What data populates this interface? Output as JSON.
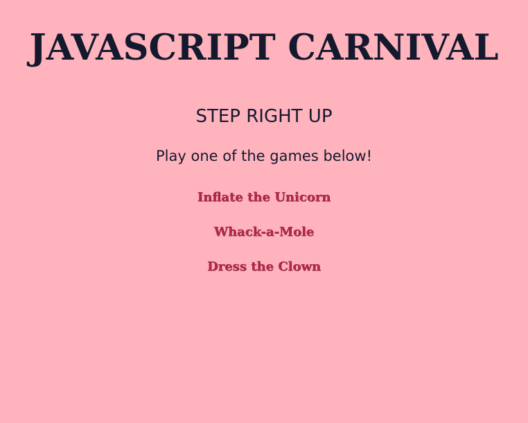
{
  "header": {
    "title": "JAVASCRIPT CARNIVAL"
  },
  "main": {
    "subtitle": "STEP RIGHT UP",
    "intro": "Play one of the games below!",
    "games": [
      {
        "label": "Inflate the Unicorn"
      },
      {
        "label": "Whack-a-Mole"
      },
      {
        "label": "Dress the Clown"
      }
    ]
  },
  "colors": {
    "background": "#ffb3bd",
    "text": "#14192e",
    "link": "#b3284a"
  }
}
